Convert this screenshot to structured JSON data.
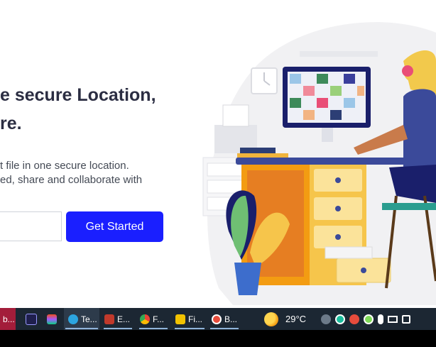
{
  "hero": {
    "headline_line1": "e secure Location,",
    "headline_line2": "re.",
    "sub_line1": "t file in one secure location.",
    "sub_line2": "ed, share and collaborate with",
    "email_value": "",
    "cta_label": "Get Started"
  },
  "taskbar": {
    "items": [
      {
        "label": "b...",
        "icon": "app-icon",
        "color": "#c0392b"
      },
      {
        "label": "",
        "icon": "after-effects-icon",
        "color": "#1f1f4d"
      },
      {
        "label": "",
        "icon": "figma-icon",
        "color": "#222"
      },
      {
        "label": "Te...",
        "icon": "telegram-icon",
        "color": "#2ca5e0"
      },
      {
        "label": "E...",
        "icon": "vscode-icon",
        "color": "#c0392b"
      },
      {
        "label": "F...",
        "icon": "chrome-icon",
        "color": "#e74c3c"
      },
      {
        "label": "Fi...",
        "icon": "file-explorer-icon",
        "color": "#f2c200"
      },
      {
        "label": "B...",
        "icon": "record-icon",
        "color": "#e74c3c"
      }
    ],
    "weather": "29°C"
  }
}
